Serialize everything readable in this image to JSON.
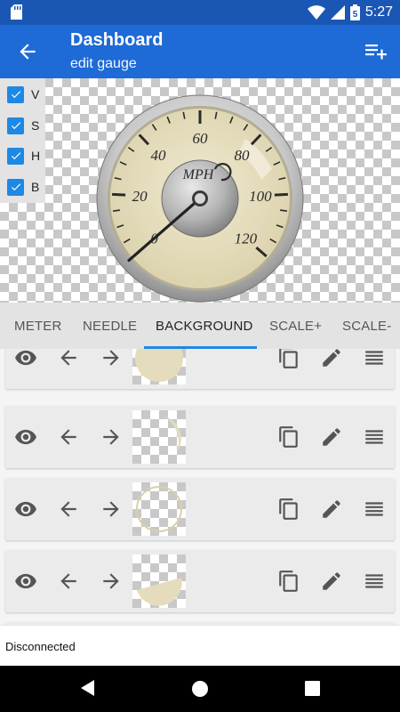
{
  "status_bar": {
    "time": "5:27",
    "battery": "5"
  },
  "app_bar": {
    "title": "Dashboard",
    "subtitle": "edit gauge"
  },
  "gauge": {
    "unit": "MPH",
    "scale_labels": [
      "0",
      "20",
      "40",
      "60",
      "80",
      "100",
      "120"
    ],
    "needle_value": 0
  },
  "checkboxes": [
    {
      "label": "V",
      "checked": true
    },
    {
      "label": "S",
      "checked": true
    },
    {
      "label": "H",
      "checked": true
    },
    {
      "label": "B",
      "checked": true
    }
  ],
  "tabs": [
    {
      "label": "METER",
      "active": false
    },
    {
      "label": "NEEDLE",
      "active": false
    },
    {
      "label": "BACKGROUND",
      "active": true
    },
    {
      "label": "SCALE+",
      "active": false
    },
    {
      "label": "SCALE-",
      "active": false
    }
  ],
  "layers": [
    {
      "shape": "full-circle"
    },
    {
      "shape": "crescent"
    },
    {
      "shape": "ring"
    },
    {
      "shape": "lower-segment"
    }
  ],
  "footer": {
    "connection_status": "Disconnected"
  },
  "colors": {
    "accent": "#1e6ad6",
    "status_bar": "#1a57b5",
    "check": "#1e88e5",
    "gauge_face": "#e4dcbc"
  }
}
